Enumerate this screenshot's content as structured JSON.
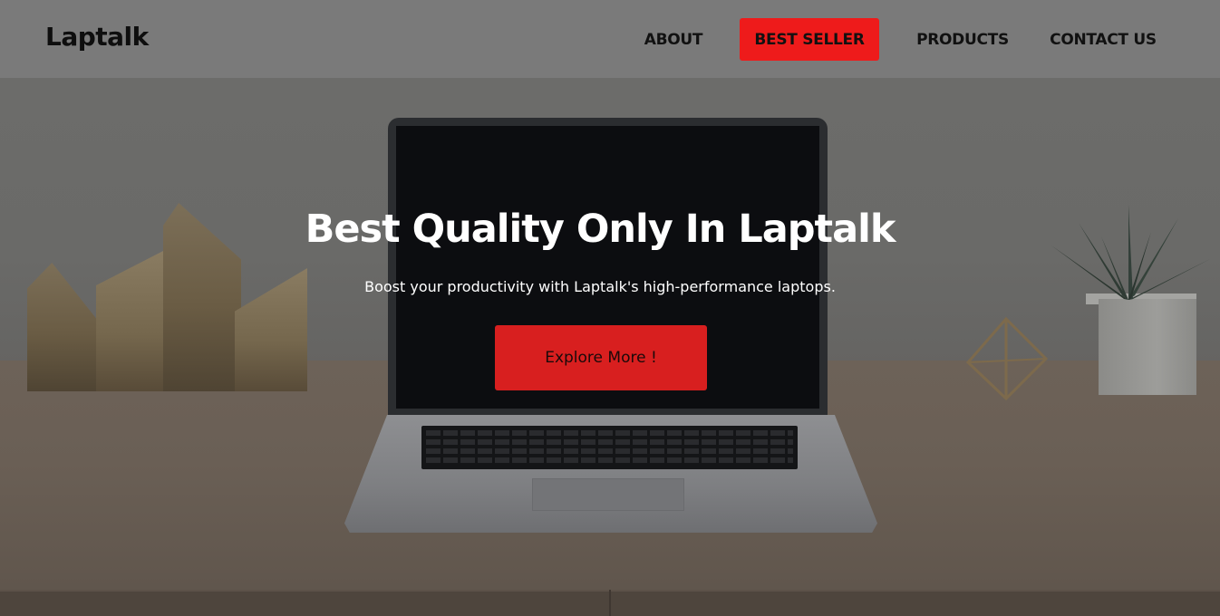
{
  "header": {
    "logo": "Laptalk",
    "nav": {
      "about": "ABOUT",
      "best_seller": "BEST SELLER",
      "products": "PRODUCTS",
      "contact_us": "CONTACT US"
    }
  },
  "hero": {
    "title": "Best Quality Only In Laptalk",
    "subtitle": "Boost your productivity with Laptalk's high-performance laptops.",
    "cta_label": "Explore More !"
  },
  "colors": {
    "accent": "#ee1b1b",
    "cta": "#d81f1f",
    "header_bg": "#7a7a7a",
    "text_light": "#ffffff",
    "text_dark": "#111111"
  },
  "icons": []
}
